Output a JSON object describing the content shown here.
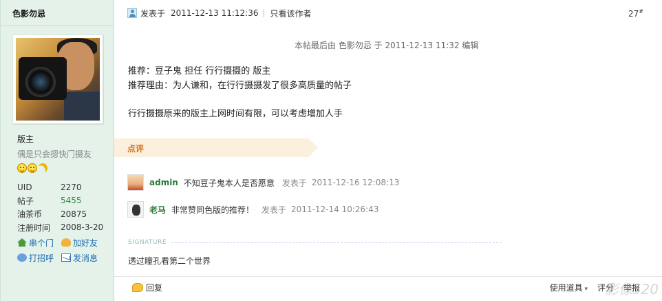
{
  "author": {
    "username": "色影勿忌",
    "rank": "版主",
    "motto": "偶是只会摁快门摄友",
    "stats": [
      {
        "label": "UID",
        "value": "2270"
      },
      {
        "label": "帖子",
        "value": "5455"
      },
      {
        "label": "油茶币",
        "value": "20875"
      },
      {
        "label": "注册时间",
        "value": "2008-3-20"
      }
    ],
    "actions": [
      {
        "label": "串个门",
        "icon": "home-icon"
      },
      {
        "label": "加好友",
        "icon": "add-friend-icon"
      },
      {
        "label": "打招呼",
        "icon": "greet-icon"
      },
      {
        "label": "发消息",
        "icon": "message-icon"
      }
    ]
  },
  "post": {
    "posted_prefix": "发表于",
    "posted_time": "2011-12-13 11:12:36",
    "author_only": "只看该作者",
    "floor": "27",
    "floor_mark": "#",
    "edit_note": "本帖最后由 色影勿忌 于 2011-12-13 11:32 编辑",
    "lines": [
      "推荐：豆子鬼 担任 行行摄摄的 版主",
      "推荐理由：为人谦和，在行行摄摄发了很多高质量的帖子"
    ],
    "line3": "行行摄摄原来的版主上网时间有限，可以考虑增加人手"
  },
  "comments_section": {
    "label": "点评",
    "items": [
      {
        "name": "admin",
        "text": "不知豆子鬼本人是否愿意",
        "time_prefix": "发表于",
        "time": "2011-12-16 12:08:13"
      },
      {
        "name": "老马",
        "text": "非常赞同色版的推荐！",
        "time_prefix": "发表于",
        "time": "2011-12-14 10:26:43"
      }
    ]
  },
  "signature": {
    "label": "SIGNATURE",
    "text": "透过瞳孔看第二个世界"
  },
  "footer": {
    "reply": "回复",
    "tools": "使用道具",
    "rate": "评分",
    "report": "举报"
  },
  "watermark": "影像520"
}
